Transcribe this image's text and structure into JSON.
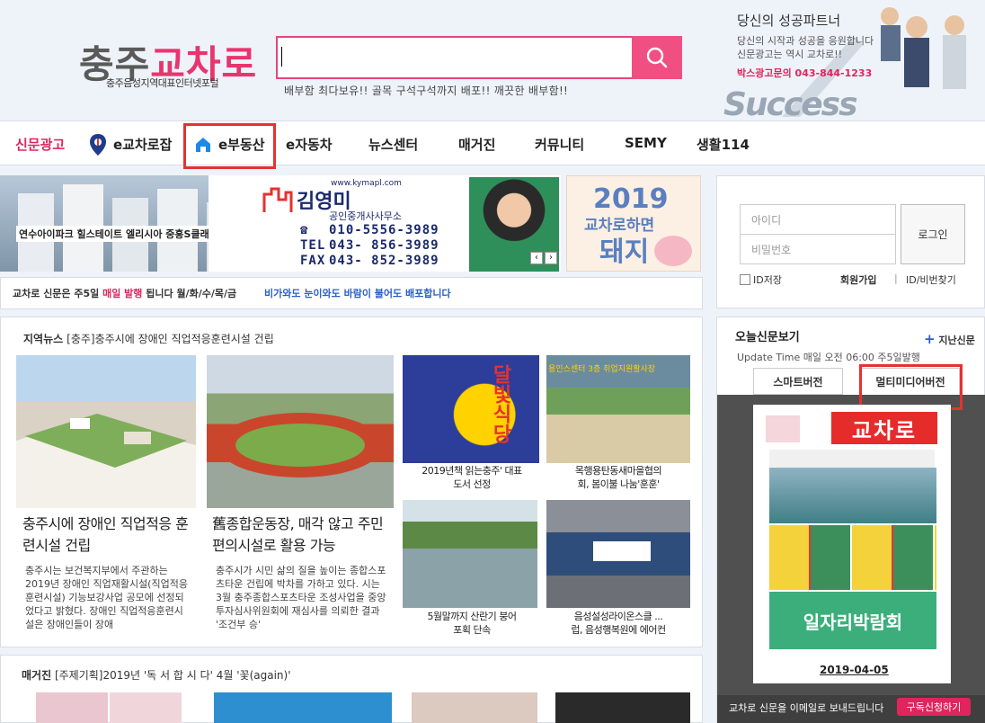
{
  "logo": {
    "main_a": "충주",
    "main_b": "교차로",
    "sub": "충주음성지역대표인터넷포털"
  },
  "search": {
    "placeholder": "",
    "notice": "배부함 최다보유!! 골목 구석구석까지 배포!! 깨끗한 배부함!!",
    "button_icon": "search-icon"
  },
  "promo": {
    "title": "당신의 성공파트너",
    "line1": "당신의 시작과 성공을 응원합니다",
    "line2": "신문광고는 역시 교차로!!",
    "phone": "박스광고문의 043-844-1233",
    "success": "Success"
  },
  "nav": {
    "items": [
      {
        "label": "신문광고"
      },
      {
        "label": "e교차로잡"
      },
      {
        "label": "e부동산"
      },
      {
        "label": "e자동차"
      },
      {
        "label": "뉴스센터"
      },
      {
        "label": "매거진"
      },
      {
        "label": "커뮤니티"
      },
      {
        "label": "SEMY"
      },
      {
        "label": "생활114"
      }
    ]
  },
  "banner": {
    "caption": "연수아이파크 힐스테이트 엘리시아 중흥S클래스",
    "url": "www.kymapl.com",
    "name": "김영미",
    "office": "공인중개사사무소",
    "tel_label1": "☎",
    "tel1": "010-5556-3989",
    "tel_label2": "TEL",
    "tel2": "043- 856-3989",
    "tel_label3": "FAX",
    "tel3": "043- 852-3989"
  },
  "pig_banner": {
    "year": "2019",
    "line1": "교차로하면",
    "line2": "돼지"
  },
  "notice": {
    "text_a": "교차로 신문은 주5일 ",
    "text_red": "매일 발행",
    "text_b": " 됩니다 월/화/수/목/금",
    "text_blue": "비가와도 눈이와도 바람이 불어도 배포합니다"
  },
  "login": {
    "id_placeholder": "아이디",
    "pw_placeholder": "비밀번호",
    "button": "로그인",
    "keep": "ID저장",
    "join": "회원가입",
    "sep": "|",
    "find": "ID/비번찾기"
  },
  "news": {
    "category": "지역뉴스",
    "heading": "[충주]충주시에 장애인 직업적응훈련시설 건립",
    "articles": [
      {
        "title": "충주시에 장애인 직업적응 훈련시설 건립",
        "body": "충주시는 보건복지부에서 주관하는 2019년 장애인 직업재활시설(직업적응 훈련시설) 기능보강사업 공모에 선정되었다고 밝혔다. 장애인 직업적응훈련시설은 장애인들이 장애"
      },
      {
        "title": "舊종합운동장, 매각 않고 주민편의시설로 활용 가능",
        "body": "충주시가 시민 삶의 질을 높이는 종합스포츠타운 건립에 박차를 가하고 있다. 시는 3월 충주종합스포츠타운 조성사업을 중앙투자심사위원회에 재심사를 의뢰한 결과 '조건부 승'"
      }
    ],
    "captions": [
      {
        "l1": "2019년책 읽는충주' 대표",
        "l2": "도서 선정"
      },
      {
        "l1": "목행용탄동새마을협의",
        "l2": "회, 봄이불 나눔'훈훈'"
      },
      {
        "l1": "5월말까지 산란기 붕어",
        "l2": "포획 단속"
      },
      {
        "l1": "음성설성라이온스클 ...",
        "l2": "럽, 음성행복원에 에어컨"
      }
    ],
    "img3_text": "달빛식당",
    "img4_text": "용인스센터 3층 취업지원활사장"
  },
  "magazine": {
    "category": "매거진",
    "heading": "[주제기획]2019년 '독 서 합 시 다' 4월 '꽃(again)'"
  },
  "paper": {
    "title": "오늘신문보기",
    "past": "지난신문",
    "update": "Update Time 매일 오전 06:00   주5일발행",
    "tab_smart": "스마트버전",
    "tab_multi": "멀티미디어버전",
    "masthead": "교차로",
    "fair": "일자리박람회",
    "date": "2019-04-05",
    "mail_text": "교차로 신문을 이메일로 보내드립니다",
    "subscribe": "구독신청하기"
  },
  "colors": {
    "accent": "#e0245e",
    "search_pink": "#f04f82",
    "highlight_red": "#e53131",
    "link_blue": "#2860c8"
  }
}
